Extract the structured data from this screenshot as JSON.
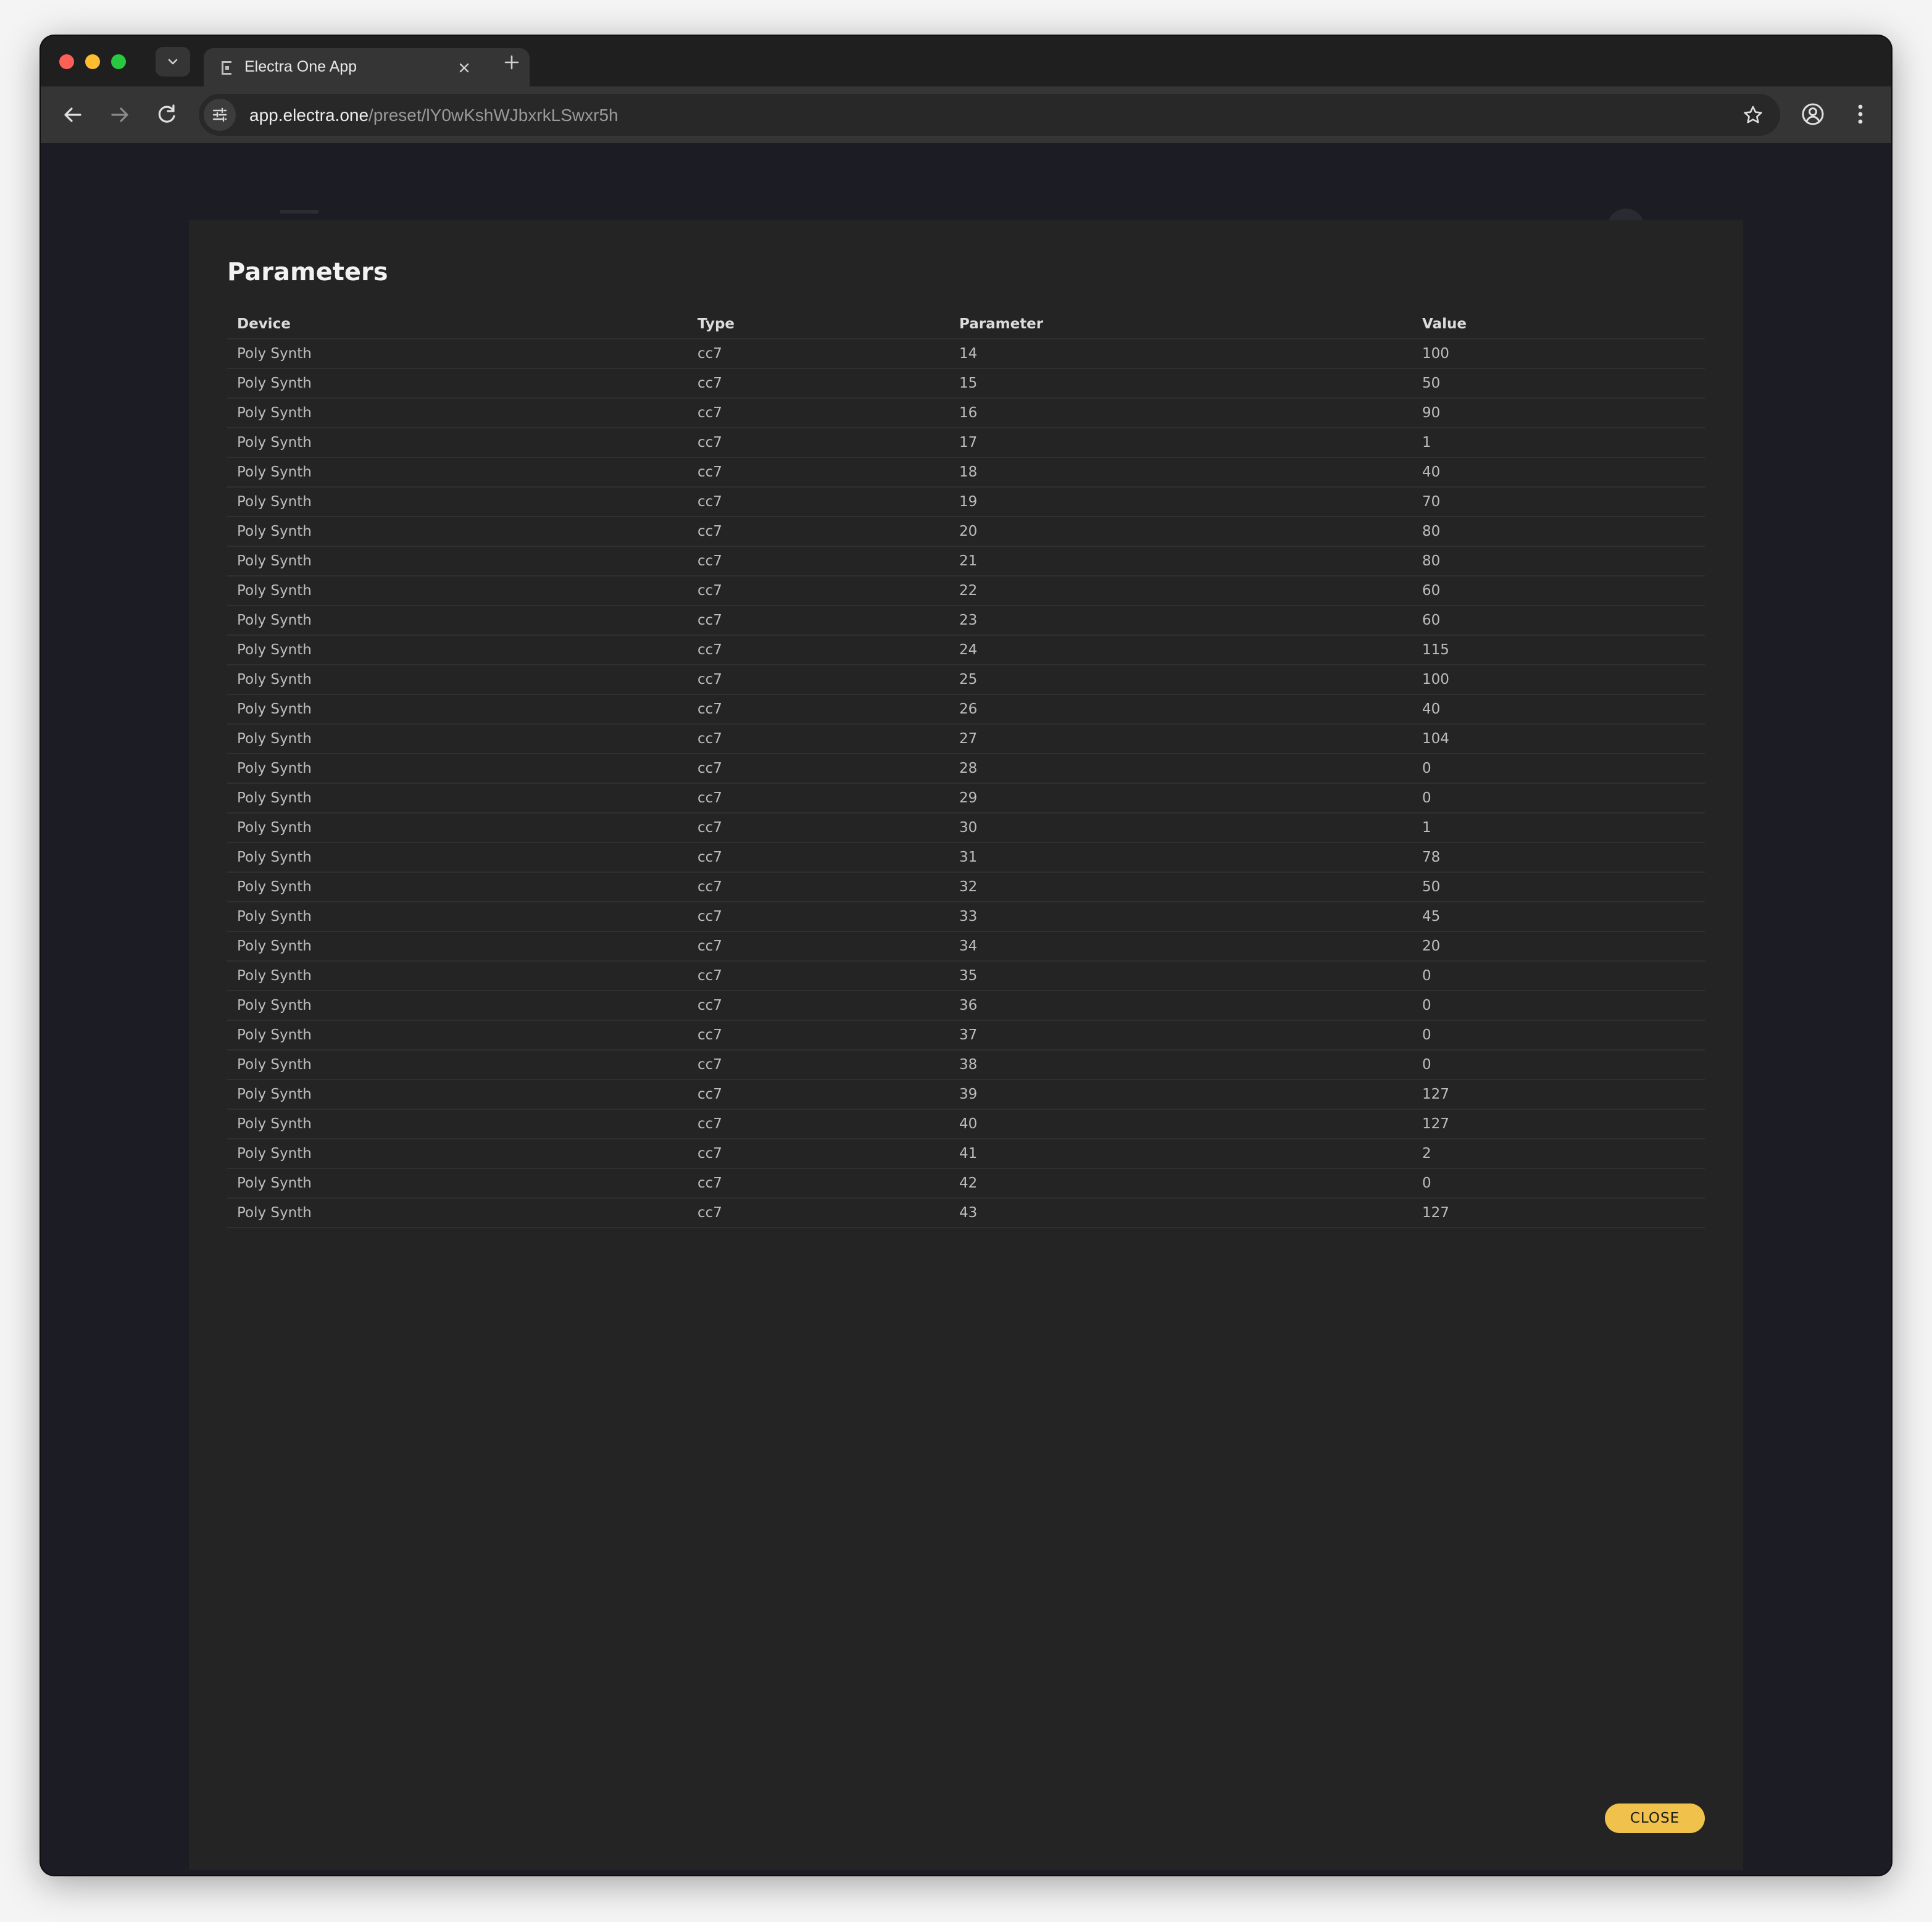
{
  "browser": {
    "tab_title": "Electra One App",
    "url_host": "app.electra.one",
    "url_path": "/preset/lY0wKshWJbxrkLSwxr5h"
  },
  "dialog": {
    "title": "Parameters",
    "columns": [
      "Device",
      "Type",
      "Parameter",
      "Value"
    ],
    "rows": [
      [
        "Poly Synth",
        "cc7",
        "14",
        "100"
      ],
      [
        "Poly Synth",
        "cc7",
        "15",
        "50"
      ],
      [
        "Poly Synth",
        "cc7",
        "16",
        "90"
      ],
      [
        "Poly Synth",
        "cc7",
        "17",
        "1"
      ],
      [
        "Poly Synth",
        "cc7",
        "18",
        "40"
      ],
      [
        "Poly Synth",
        "cc7",
        "19",
        "70"
      ],
      [
        "Poly Synth",
        "cc7",
        "20",
        "80"
      ],
      [
        "Poly Synth",
        "cc7",
        "21",
        "80"
      ],
      [
        "Poly Synth",
        "cc7",
        "22",
        "60"
      ],
      [
        "Poly Synth",
        "cc7",
        "23",
        "60"
      ],
      [
        "Poly Synth",
        "cc7",
        "24",
        "115"
      ],
      [
        "Poly Synth",
        "cc7",
        "25",
        "100"
      ],
      [
        "Poly Synth",
        "cc7",
        "26",
        "40"
      ],
      [
        "Poly Synth",
        "cc7",
        "27",
        "104"
      ],
      [
        "Poly Synth",
        "cc7",
        "28",
        "0"
      ],
      [
        "Poly Synth",
        "cc7",
        "29",
        "0"
      ],
      [
        "Poly Synth",
        "cc7",
        "30",
        "1"
      ],
      [
        "Poly Synth",
        "cc7",
        "31",
        "78"
      ],
      [
        "Poly Synth",
        "cc7",
        "32",
        "50"
      ],
      [
        "Poly Synth",
        "cc7",
        "33",
        "45"
      ],
      [
        "Poly Synth",
        "cc7",
        "34",
        "20"
      ],
      [
        "Poly Synth",
        "cc7",
        "35",
        "0"
      ],
      [
        "Poly Synth",
        "cc7",
        "36",
        "0"
      ],
      [
        "Poly Synth",
        "cc7",
        "37",
        "0"
      ],
      [
        "Poly Synth",
        "cc7",
        "38",
        "0"
      ],
      [
        "Poly Synth",
        "cc7",
        "39",
        "127"
      ],
      [
        "Poly Synth",
        "cc7",
        "40",
        "127"
      ],
      [
        "Poly Synth",
        "cc7",
        "41",
        "2"
      ],
      [
        "Poly Synth",
        "cc7",
        "42",
        "0"
      ],
      [
        "Poly Synth",
        "cc7",
        "43",
        "127"
      ]
    ],
    "close_label": "CLOSE"
  },
  "icons": {
    "tab_search": "chevron-down-icon",
    "favicon": "electra-logo-icon",
    "tab_close": "close-icon",
    "new_tab": "plus-icon",
    "back": "arrow-left-icon",
    "forward": "arrow-right-icon",
    "reload": "reload-icon",
    "site_info": "tune-icon",
    "bookmark": "star-icon",
    "profile": "account-circle-icon",
    "menu": "kebab-menu-icon"
  },
  "colors": {
    "accent": "#f0c14b",
    "dialog_bg": "#242424",
    "page_bg": "#1c1c24"
  }
}
